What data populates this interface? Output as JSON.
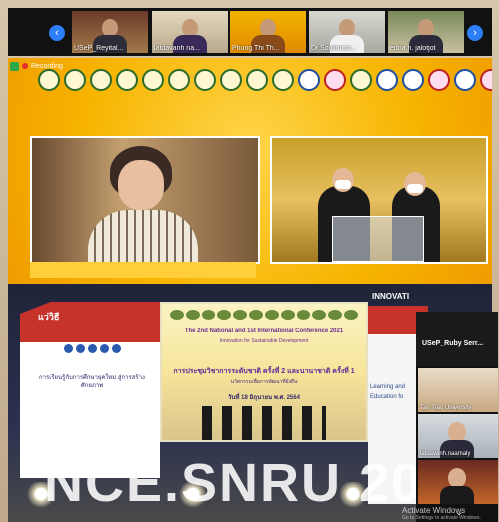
{
  "participants": [
    {
      "name": "USeP_Reyital..."
    },
    {
      "name": "latdavanh na..."
    },
    {
      "name": "Phung Thi Th..."
    },
    {
      "name": "Dr.Soulinhon..."
    },
    {
      "name": "edna n. jalotjot"
    }
  ],
  "recording": {
    "label": "Recording"
  },
  "stage": {
    "screen_title": "The 2nd National and 1st International Conference 2021",
    "screen_subtitle": "Innovation for Sustainable Development",
    "screen_thai_1": "การประชุมวิชาการระดับชาติ ครั้งที่ 2 และนานาชาติ ครั้งที่ 1",
    "screen_thai_2": "นวัตกรรมเพื่อการพัฒนาที่ยั่งยืน",
    "screen_date": "วันที่ 18 มิถุนายน พ.ศ. 2564",
    "floor_text": "NCE.SNRU 20",
    "left_stand_heading": "แว่วิธี",
    "left_stand_text": "การเรียนรู้กับการศึกษายุคใหม่ สู่การสร้างศักยภาพ",
    "right_stand_heading": "INNOVATI",
    "right_stand_line_1": "Learning and",
    "right_stand_line_2": "Education fo"
  },
  "side_panel": {
    "header_name": "USeP_Ruby  Serr...",
    "tiles": [
      {
        "name": "Tan Trao University"
      },
      {
        "name": "latdavanh.naamaly"
      },
      {
        "name": ""
      }
    ]
  },
  "watermark": {
    "title": "Activate Windows",
    "subtitle": "Go to Settings to activate Windows."
  }
}
